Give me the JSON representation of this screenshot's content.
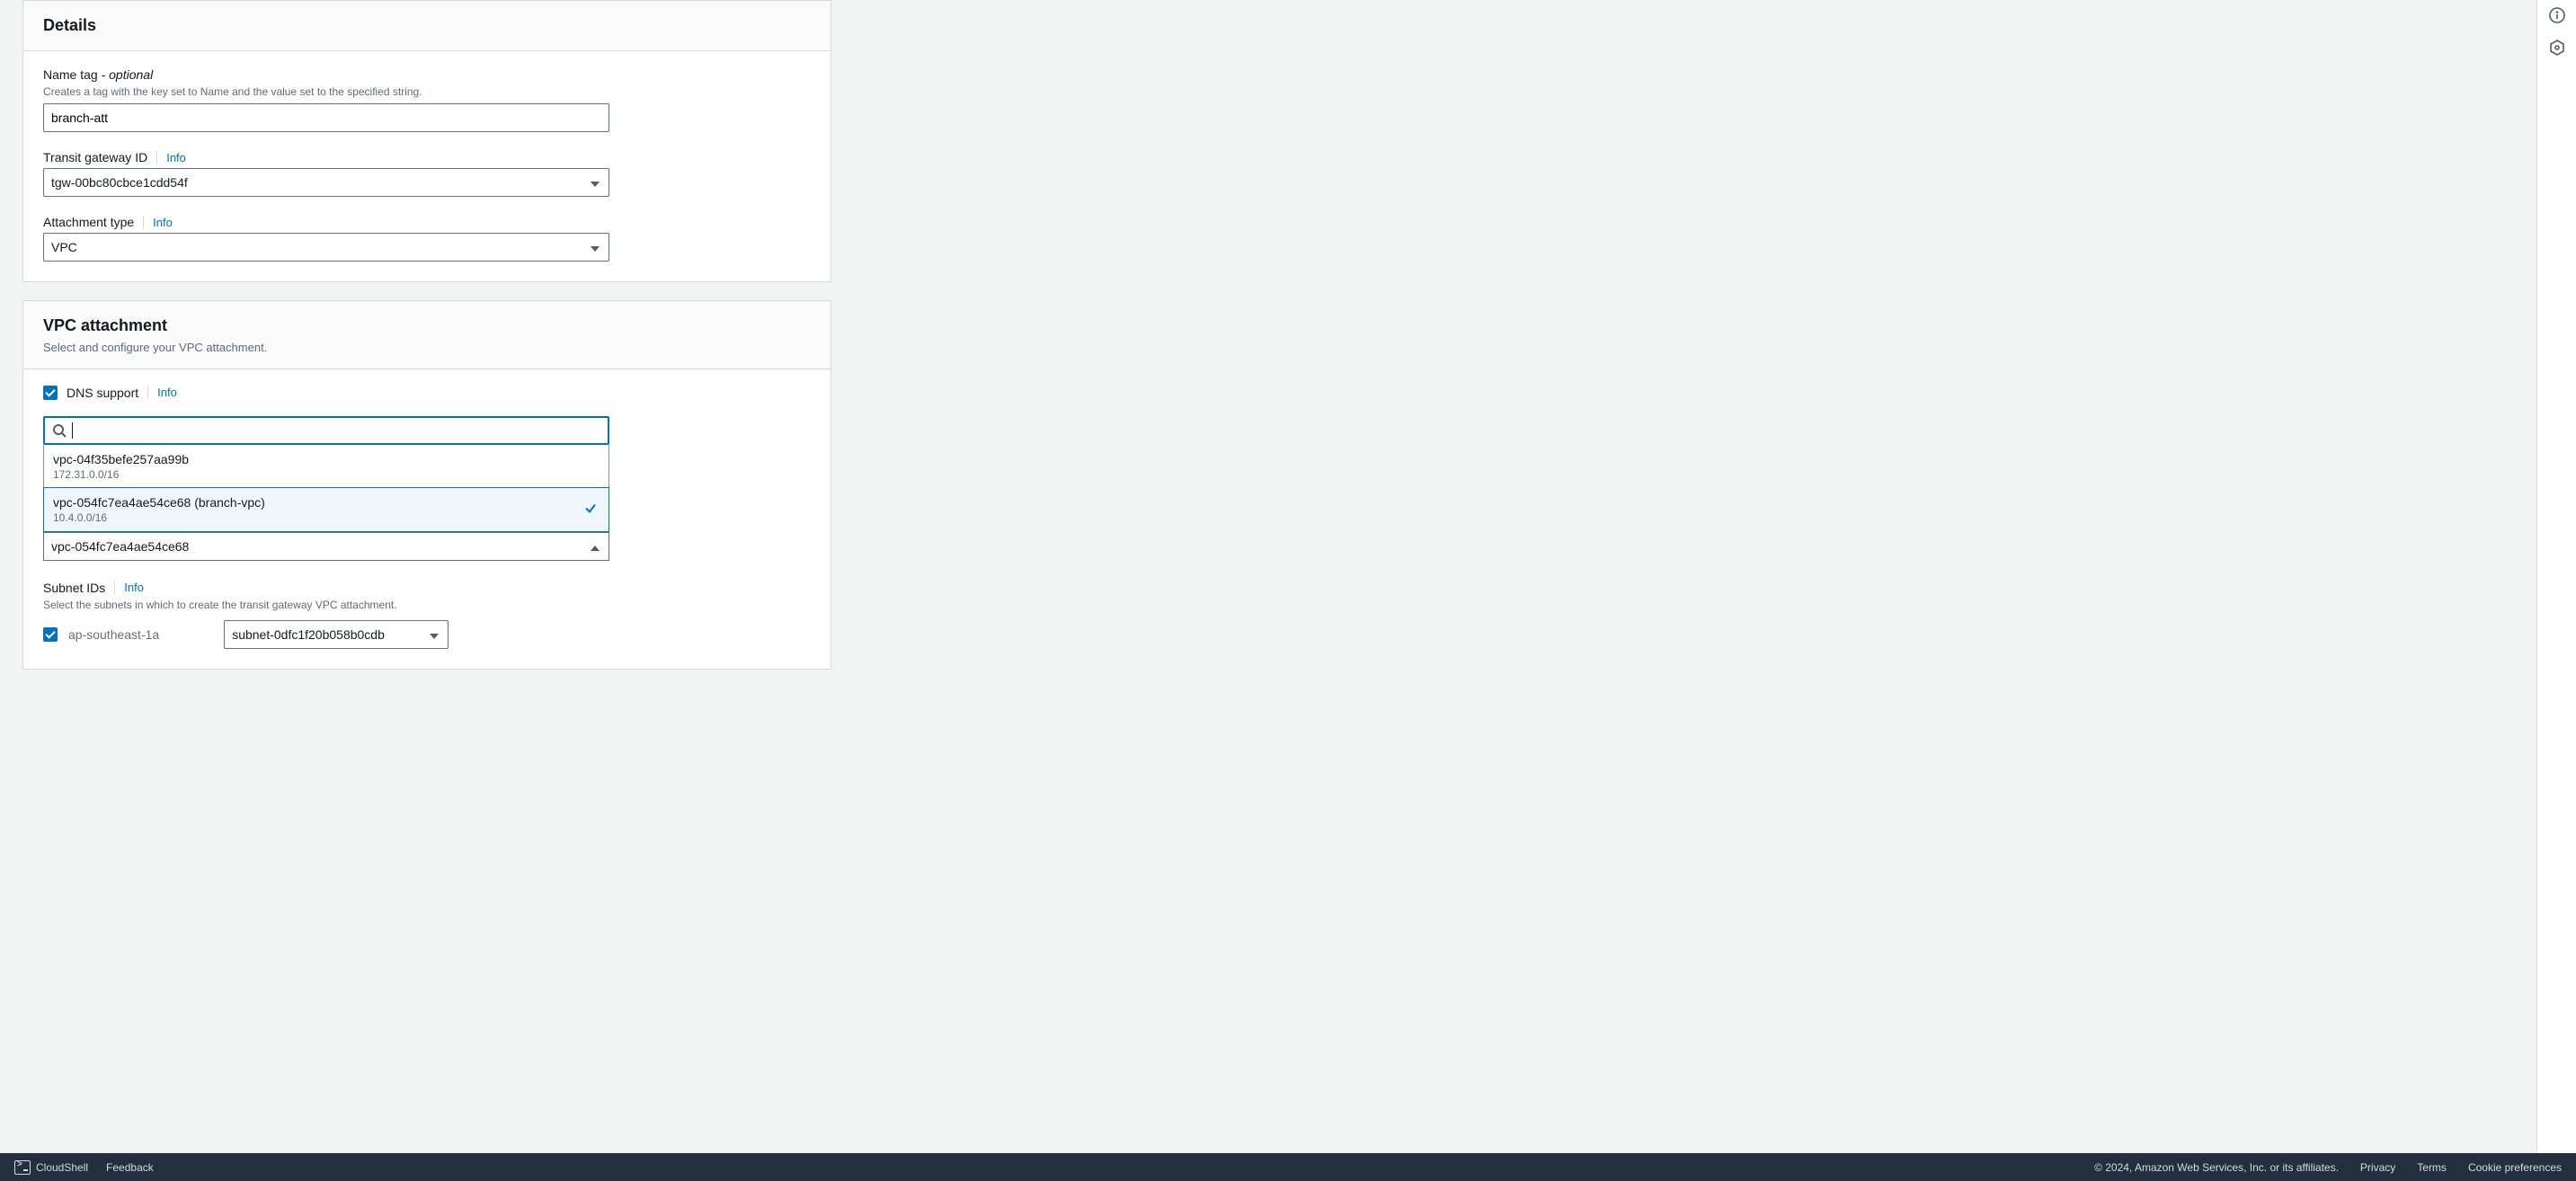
{
  "details": {
    "title": "Details",
    "name_tag_label": "Name tag",
    "name_tag_optional": " - optional",
    "name_tag_help": "Creates a tag with the key set to Name and the value set to the specified string.",
    "name_tag_value": "branch-att",
    "tgw_label": "Transit gateway ID",
    "tgw_info": "Info",
    "tgw_value": "tgw-00bc80cbce1cdd54f",
    "att_type_label": "Attachment type",
    "att_type_info": "Info",
    "att_type_value": "VPC"
  },
  "vpc": {
    "title": "VPC attachment",
    "subtitle": "Select and configure your VPC attachment.",
    "dns_label": "DNS support",
    "dns_info": "Info",
    "options": [
      {
        "id": "vpc-04f35befe257aa99b",
        "cidr": "172.31.0.0/16",
        "selected": false
      },
      {
        "id": "vpc-054fc7ea4ae54ce68 (branch-vpc)",
        "cidr": "10.4.0.0/16",
        "selected": true
      }
    ],
    "selected_display": "vpc-054fc7ea4ae54ce68",
    "subnet_label": "Subnet IDs",
    "subnet_info": "Info",
    "subnet_help": "Select the subnets in which to create the transit gateway VPC attachment.",
    "subnet_az": "ap-southeast-1a",
    "subnet_value": "subnet-0dfc1f20b058b0cdb"
  },
  "footer": {
    "cloudshell": "CloudShell",
    "feedback": "Feedback",
    "copyright": "© 2024, Amazon Web Services, Inc. or its affiliates.",
    "privacy": "Privacy",
    "terms": "Terms",
    "cookie": "Cookie preferences"
  }
}
